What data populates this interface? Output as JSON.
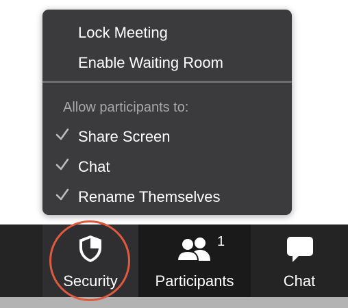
{
  "menu": {
    "items": [
      {
        "label": "Lock Meeting"
      },
      {
        "label": "Enable Waiting Room"
      }
    ],
    "section_label": "Allow participants to:",
    "permissions": [
      {
        "label": "Share Screen",
        "checked": true
      },
      {
        "label": "Chat",
        "checked": true
      },
      {
        "label": "Rename Themselves",
        "checked": true
      }
    ]
  },
  "toolbar": {
    "security": {
      "label": "Security",
      "icon": "shield-icon"
    },
    "participants": {
      "label": "Participants",
      "icon": "participants-icon",
      "count": "1"
    },
    "chat": {
      "label": "Chat",
      "icon": "chat-bubble-icon"
    }
  },
  "colors": {
    "menu_bg": "#3b3b3d",
    "toolbar_bg": "#242424",
    "highlight_ring": "#e05a3f"
  }
}
